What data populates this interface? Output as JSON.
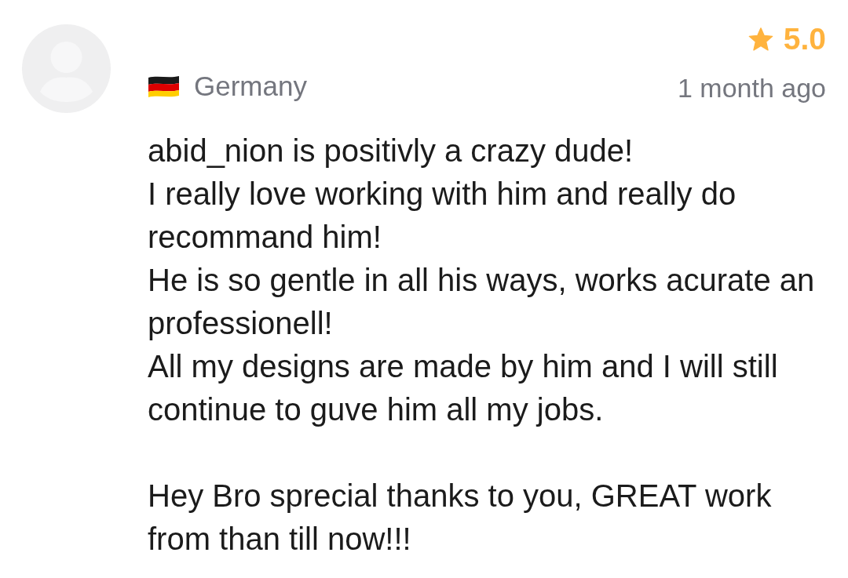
{
  "reviewer": {
    "country": "Germany"
  },
  "rating": {
    "value": "5.0"
  },
  "time": "1 month ago",
  "review": {
    "paragraphs": [
      "abid_nion is positivly a crazy dude!\nI really love working with him and really do recommand him!\nHe is so gentle in all his ways, works acurate an professionell!\nAll my designs are made by him and I will still continue to guve him all my jobs.",
      "Hey Bro sprecial thanks to you, GREAT work from than till now!!!"
    ]
  }
}
